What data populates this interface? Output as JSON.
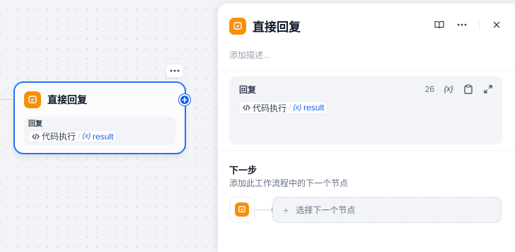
{
  "canvas": {
    "node": {
      "title": "直接回复",
      "body_label": "回复",
      "var_source": "代码执行",
      "var_sep": "/",
      "var_badge": "{x}",
      "var_name": "result",
      "more_label": "···"
    }
  },
  "panel": {
    "title": "直接回复",
    "description_placeholder": "添加描述...",
    "reply": {
      "label": "回复",
      "count": "26",
      "var_badge": "{x}",
      "var_source": "代码执行",
      "var_sep": "/",
      "var_name": "result"
    },
    "next_step": {
      "title": "下一步",
      "subtitle": "添加此工作流程中的下一个节点",
      "select_label": "选择下一个节点",
      "plus": "+"
    }
  },
  "colors": {
    "accent": "#2970ff",
    "icon_bg": "#f79009",
    "var_blue": "#155eef"
  },
  "icons": [
    "answer-icon",
    "more-icon",
    "book-icon",
    "close-icon",
    "variable-icon",
    "clipboard-icon",
    "expand-icon",
    "code-icon",
    "add-icon"
  ]
}
